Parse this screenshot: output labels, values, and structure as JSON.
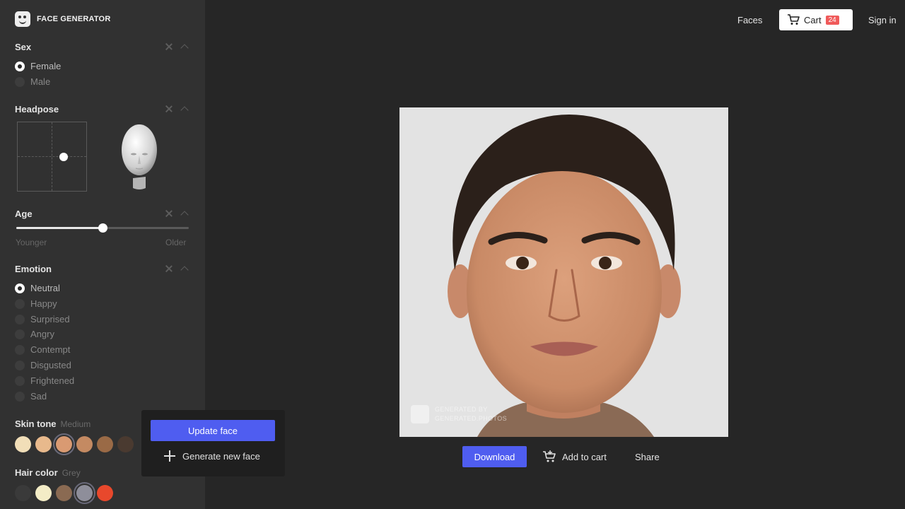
{
  "brand": {
    "name": "FACE GENERATOR"
  },
  "nav": {
    "faces": "Faces",
    "cart": "Cart",
    "cart_count": "24",
    "sign_in": "Sign in"
  },
  "sidebar": {
    "sex": {
      "title": "Sex",
      "options": [
        "Female",
        "Male"
      ],
      "selected": "Female"
    },
    "headpose": {
      "title": "Headpose"
    },
    "age": {
      "title": "Age",
      "min_label": "Younger",
      "max_label": "Older",
      "value": 0.5
    },
    "emotion": {
      "title": "Emotion",
      "options": [
        "Neutral",
        "Happy",
        "Surprised",
        "Angry",
        "Contempt",
        "Disgusted",
        "Frightened",
        "Sad"
      ],
      "selected": "Neutral"
    },
    "skin_tone": {
      "title": "Skin tone",
      "selected_label": "Medium",
      "colors": [
        "#f1deb8",
        "#e8b98c",
        "#d99a72",
        "#c48a62",
        "#9a6a46",
        "#4a3a30"
      ],
      "selected_index": 2
    },
    "hair_color": {
      "title": "Hair color",
      "selected_label": "Grey",
      "colors": [
        "#3a3a3a",
        "#f3ecc6",
        "#8a6a52",
        "#8e8e9a",
        "#e8482c"
      ],
      "selected_index": 3
    }
  },
  "popup": {
    "update": "Update face",
    "generate": "Generate new face"
  },
  "watermark": {
    "line1": "GENERATED BY",
    "line2": "GENERATED.PHOTOS"
  },
  "actions": {
    "download": "Download",
    "add_to_cart": "Add to cart",
    "share": "Share"
  },
  "colors": {
    "accent": "#4f5df0",
    "badge": "#f05a5a"
  }
}
